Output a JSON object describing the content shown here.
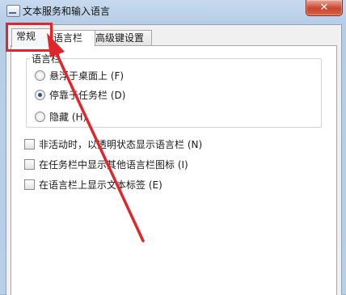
{
  "window": {
    "title": "文本服务和输入语言",
    "close_glyph": "✕"
  },
  "tabs": [
    {
      "label": "常规"
    },
    {
      "label": "语言栏"
    },
    {
      "label": "高级键设置"
    }
  ],
  "language_bar_group": {
    "title": "语言栏",
    "options": [
      {
        "label": "悬浮于桌面上 (F)",
        "checked": false
      },
      {
        "label": "停靠于任务栏 (D)",
        "checked": true
      },
      {
        "label": "隐藏 (H)",
        "checked": false
      }
    ]
  },
  "checkboxes": [
    {
      "label": "非活动时，以透明状态显示语言栏 (N)",
      "checked": false
    },
    {
      "label": "在任务栏中显示其他语言栏图标 (I)",
      "checked": false
    },
    {
      "label": "在语言栏上显示文本标签 (E)",
      "checked": false
    }
  ],
  "colors": {
    "annotation_red": "#e0262a"
  }
}
